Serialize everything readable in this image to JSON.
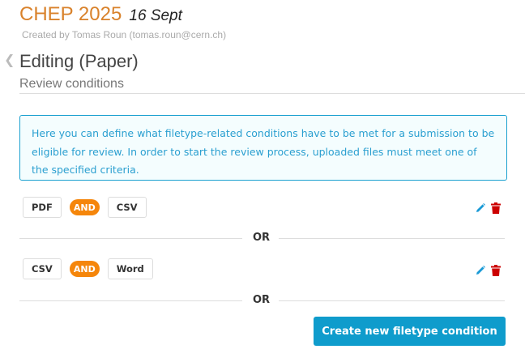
{
  "event": {
    "name": "CHEP 2025",
    "date": "16 Sept",
    "creator": "Created by Tomas Roun (tomas.roun@cern.ch)"
  },
  "page": {
    "title": "Editing (Paper)",
    "subtitle": "Review conditions",
    "back_icon": "chevron-left-icon"
  },
  "info": "Here you can define what filetype-related conditions have to be met for a submission to be eligible for review. In order to start the review process, uploaded files must meet one of the specified criteria.",
  "conditions": [
    {
      "a": "PDF",
      "op": "AND",
      "b": "CSV"
    },
    {
      "a": "CSV",
      "op": "AND",
      "b": "Word"
    }
  ],
  "separator": "OR",
  "create_button": "Create new filetype condition",
  "colors": {
    "accent": "#d9822b",
    "primary": "#0f9ccc",
    "and_badge": "#f5860b",
    "delete": "#cc0000",
    "edit": "#1a9ad6"
  }
}
